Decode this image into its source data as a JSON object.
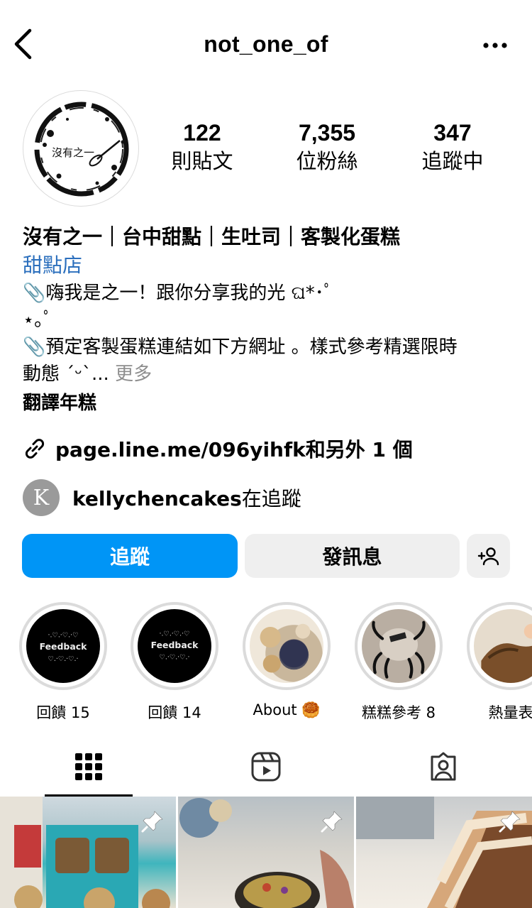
{
  "header": {
    "username": "not_one_of"
  },
  "avatar": {
    "logo_text": "沒有之一"
  },
  "stats": [
    {
      "number": "122",
      "label": "則貼文"
    },
    {
      "number": "7,355",
      "label": "位粉絲"
    },
    {
      "number": "347",
      "label": "追蹤中"
    }
  ],
  "bio": {
    "name": "沒有之一｜台中甜點｜生吐司｜客製化蛋糕",
    "category": "甜點店",
    "line1": "📎嗨我是之一！跟你分享我的光 ଘ*･ﾟ",
    "line2": "⋆｡ﾟ",
    "line3": "📎預定客製蛋糕連結如下方網址 。樣式參考精選限時",
    "line4": "動態 ˊᵕˋ...",
    "more": "更多",
    "translate": "翻譯年糕"
  },
  "link": {
    "text": "page.line.me/096yihfk和另外 1 個"
  },
  "followed_by": {
    "initial": "K",
    "user": "kellychencakes",
    "suffix": "在追蹤"
  },
  "buttons": {
    "follow": "追蹤",
    "message": "發訊息"
  },
  "highlights": [
    {
      "label": "回饋 15",
      "badge": "Feedback"
    },
    {
      "label": "回饋 14",
      "badge": "Feedback"
    },
    {
      "label": "About 🥮"
    },
    {
      "label": "糕糕參考 8"
    },
    {
      "label": "熱量表"
    }
  ],
  "tabs": [
    "grid-icon",
    "reels-icon",
    "tagged-icon"
  ],
  "colors": {
    "accent": "#0095f6",
    "secondary_button": "#efefef",
    "link_blue": "#2b6fbd"
  }
}
